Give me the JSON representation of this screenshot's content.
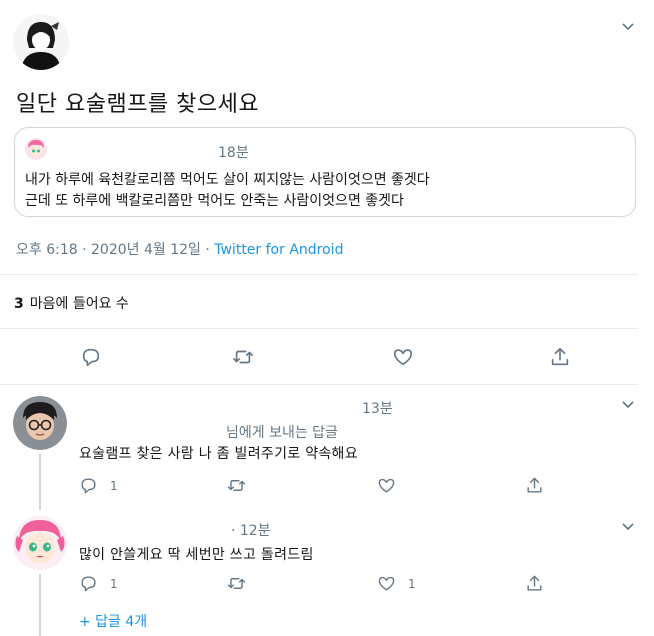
{
  "tweet": {
    "text": "일단 요술램프를 찾으세요",
    "meta_time": "오후 6:18 · 2020년 4월 12일 · ",
    "meta_source": "Twitter for Android",
    "likes_count": "3",
    "likes_label": "마음에 들어요 수"
  },
  "quote": {
    "time": "18분",
    "line1": "내가 하루에 육천칼로리쯤 먹어도 살이 찌지않는 사람이엇으면 좋겟다",
    "line2": "근데 또 하루에 백칼로리쯤만 먹어도 안죽는 사람이엇으면 좋겟다"
  },
  "replies": [
    {
      "time": "13분",
      "reply_to": "님에게 보내는 답글",
      "text": "요술램프 찾은 사람 나 좀 빌려주기로 약속해요",
      "reply_count": "1",
      "like_count": ""
    },
    {
      "time": "· 12분",
      "text": "많이 안쓸게요 딱 세번만 쓰고 돌려드림",
      "reply_count": "1",
      "like_count": "1"
    }
  ],
  "more_replies": "+ 답글 4개",
  "icons": {
    "reply": "reply-icon",
    "retweet": "retweet-icon",
    "like": "heart-icon",
    "share": "share-icon",
    "menu": "chevron-down-icon"
  },
  "colors": {
    "link": "#1b95e0",
    "muted": "#657786",
    "border": "#ccd6dd"
  }
}
